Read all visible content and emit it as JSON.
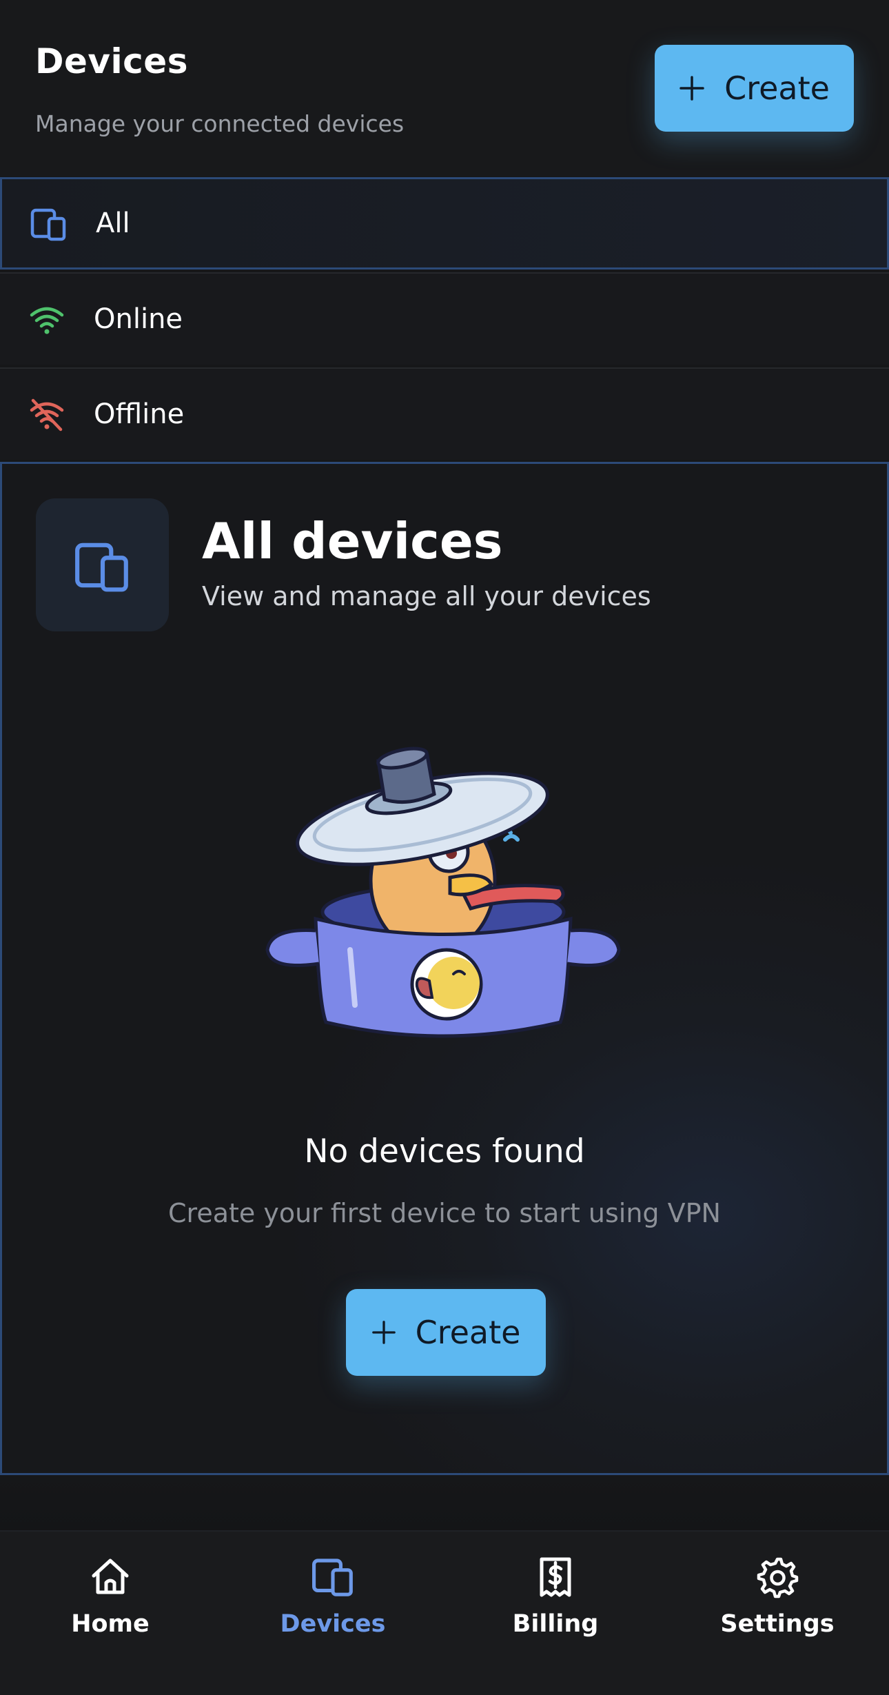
{
  "header": {
    "title": "Devices",
    "subtitle": "Manage your connected devices",
    "create_label": "Create",
    "create_icon": "plus-icon"
  },
  "filters": [
    {
      "label": "All",
      "icon": "devices-icon",
      "icon_color": "#5b8de6",
      "selected": true
    },
    {
      "label": "Online",
      "icon": "wifi-icon",
      "icon_color": "#4fc26c",
      "selected": false
    },
    {
      "label": "Offline",
      "icon": "wifi-off-icon",
      "icon_color": "#e0655a",
      "selected": false
    }
  ],
  "panel": {
    "title": "All devices",
    "subtitle": "View and manage all your devices",
    "icon": "devices-icon",
    "empty_title": "No devices found",
    "empty_subtitle": "Create your first device to start using VPN",
    "create_label": "Create"
  },
  "nav": [
    {
      "label": "Home",
      "icon": "home-icon",
      "active": false
    },
    {
      "label": "Devices",
      "icon": "devices-icon",
      "active": true
    },
    {
      "label": "Billing",
      "icon": "receipt-dollar-icon",
      "active": false
    },
    {
      "label": "Settings",
      "icon": "gear-icon",
      "active": false
    }
  ],
  "colors": {
    "accent": "#5db8f1",
    "active_nav": "#6d99e8",
    "border_selected": "#2c4a78",
    "background": "#161719"
  }
}
